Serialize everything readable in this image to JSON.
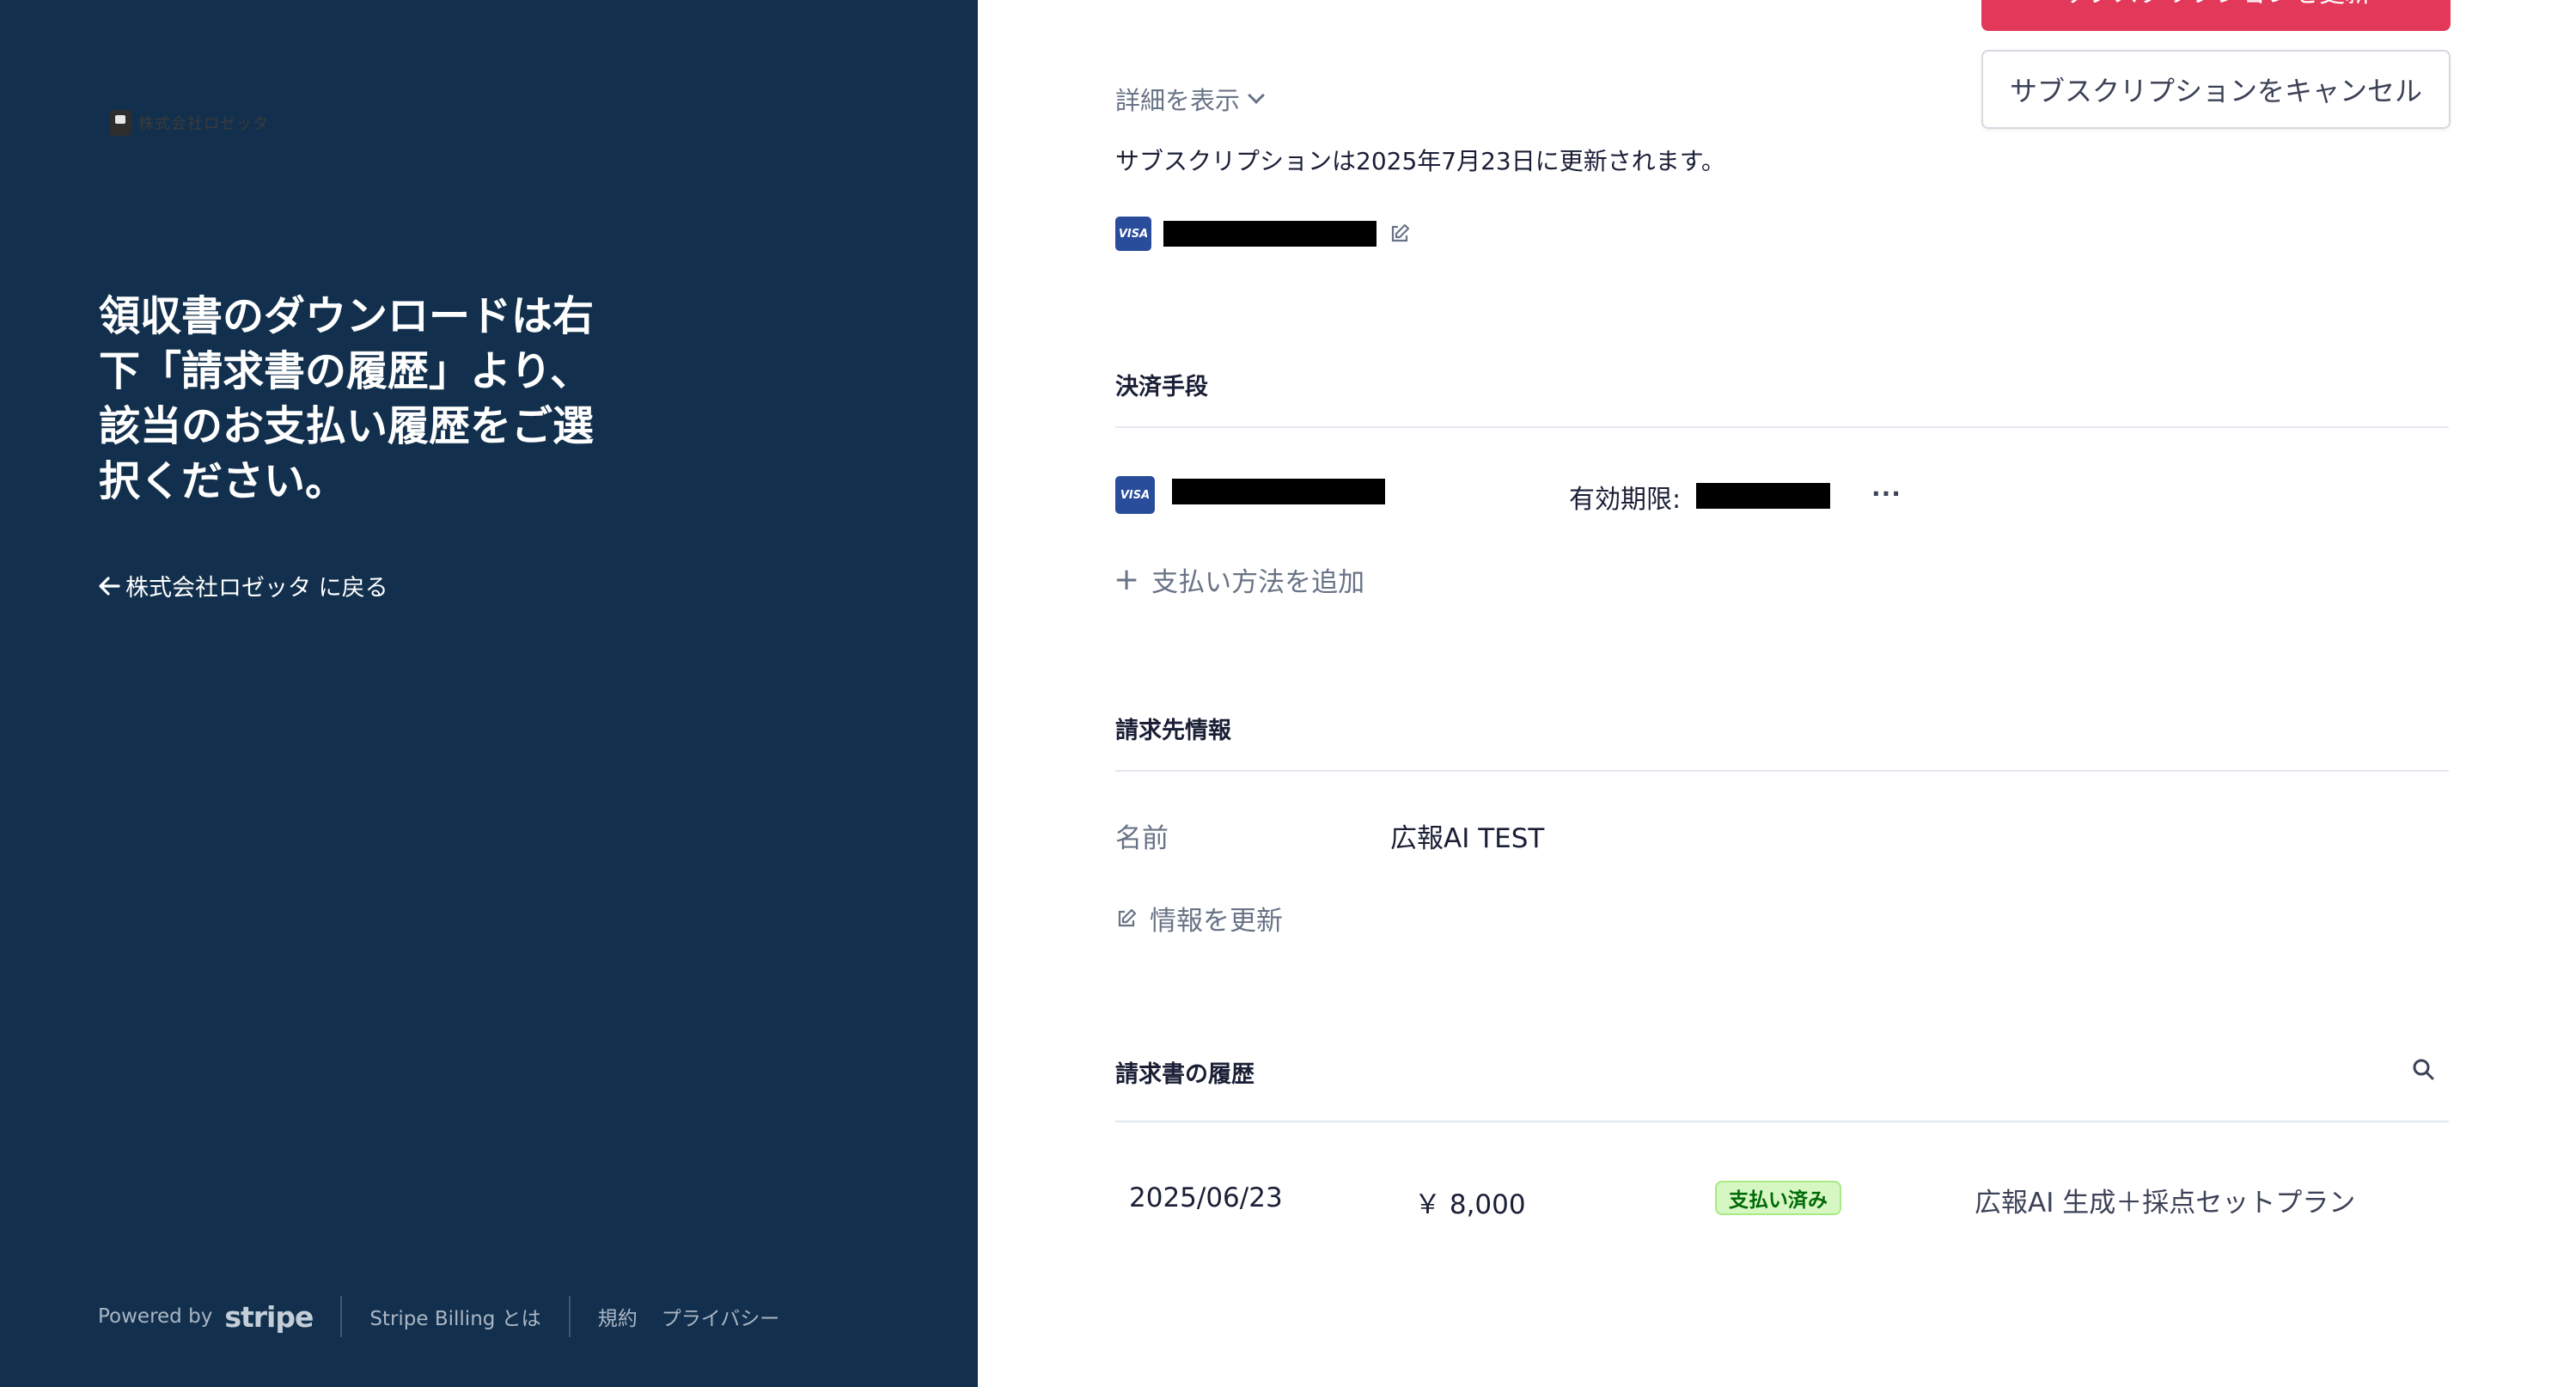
{
  "left_panel": {
    "brand_name": "株式会社ロゼッタ",
    "headline_lines": [
      "領収書のダウンロードは右",
      "下「請求書の履歴」より、",
      "該当のお支払い履歴をご選",
      "択ください。"
    ],
    "back_link": "株式会社ロゼッタ に戻る",
    "footer": {
      "powered_by": "Powered by",
      "stripe_logo": "stripe",
      "billing_link": "Stripe Billing とは",
      "terms_link": "規約",
      "privacy_link": "プライバシー"
    }
  },
  "subscription": {
    "update_button": "サブスクリプションを更新",
    "cancel_button": "サブスクリプションをキャンセル",
    "show_details": "詳細を表示",
    "renewal_text": "サブスクリプションは2025年7月23日に更新されます。",
    "card_brand": "VISA"
  },
  "payment_methods": {
    "title": "決済手段",
    "card_brand": "VISA",
    "expiry_label": "有効期限:",
    "more_icon": "ellipsis-icon",
    "add_method": "支払い方法を追加"
  },
  "billing_info": {
    "title": "請求先情報",
    "name_label": "名前",
    "name_value": "広報AI TEST",
    "update_info": "情報を更新"
  },
  "invoice_history": {
    "title": "請求書の履歴",
    "rows": [
      {
        "date": "2025/06/23",
        "amount": "￥ 8,000",
        "status": "支払い済み",
        "description": "広報AI 生成＋採点セットプラン"
      }
    ]
  },
  "colors": {
    "left_bg": "#12304d",
    "accent": "#e2385a",
    "visa": "#2a4d9b",
    "paid_badge_bg": "#d7f7c2",
    "paid_badge_text": "#006908"
  }
}
